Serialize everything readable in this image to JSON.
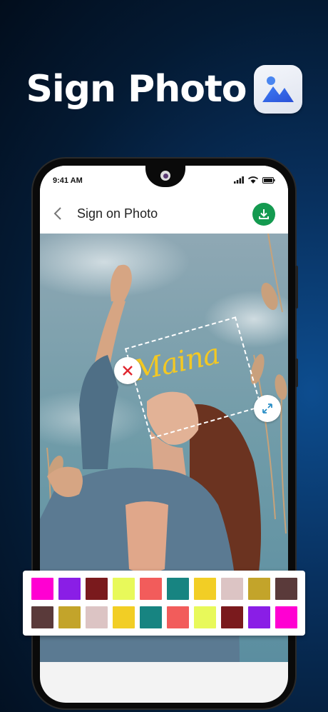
{
  "hero": {
    "title": "Sign Photo",
    "icon": "photo-app-icon"
  },
  "status_bar": {
    "time": "9:41 AM"
  },
  "app_bar": {
    "title": "Sign on Photo",
    "back_icon": "chevron-left-icon",
    "download_icon": "download-icon"
  },
  "signature": {
    "text": "Maina",
    "color": "#f3c823"
  },
  "controls": {
    "delete_icon": "close-icon",
    "resize_icon": "resize-icon"
  },
  "palette": {
    "row1": [
      "#ff00d2",
      "#8a1ee6",
      "#7a1a1d",
      "#e8f95a",
      "#f25c5b",
      "#178481",
      "#f2ce25",
      "#dcc4c4",
      "#c3a42a",
      "#5a3a3a"
    ],
    "row2": [
      "#5a3a3a",
      "#c3a42a",
      "#dcc4c4",
      "#f2ce25",
      "#178481",
      "#f25c5b",
      "#e8f95a",
      "#7a1a1d",
      "#8a1ee6",
      "#ff00d2"
    ]
  }
}
